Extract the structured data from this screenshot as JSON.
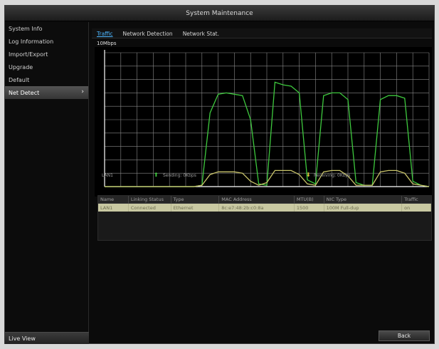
{
  "window": {
    "title": "System Maintenance"
  },
  "sidebar": {
    "items": [
      {
        "label": "System Info",
        "active": false
      },
      {
        "label": "Log Information",
        "active": false
      },
      {
        "label": "Import/Export",
        "active": false
      },
      {
        "label": "Upgrade",
        "active": false
      },
      {
        "label": "Default",
        "active": false
      },
      {
        "label": "Net Detect",
        "active": true,
        "arrow": "›"
      }
    ],
    "bottom_label": "Live View"
  },
  "tabs": [
    {
      "label": "Traffic",
      "active": true
    },
    {
      "label": "Network Detection",
      "active": false
    },
    {
      "label": "Network Stat.",
      "active": false
    }
  ],
  "graph": {
    "unit_label": "10Mbps",
    "legend": {
      "interface": "LAN1",
      "send_label": "Sending: 0Kbps",
      "receive_label": "Receiving: 0Kbps",
      "send_icon": "arrow-up-icon",
      "receive_icon": "arrow-down-icon"
    },
    "colors": {
      "grid": "#8a8a8a",
      "send": "#3ec93e",
      "receive": "#c9c46a",
      "axis": "#ffffff"
    }
  },
  "chart_data": {
    "type": "line",
    "title": "",
    "xlabel": "",
    "ylabel": "10Mbps",
    "grid": true,
    "y_gridlines": 10,
    "x_gridlines": 20,
    "ylim": [
      0,
      10
    ],
    "x": [
      0,
      1,
      2,
      3,
      4,
      5,
      6,
      7,
      8,
      9,
      10,
      11,
      12,
      13,
      14,
      15,
      16,
      17,
      18,
      19,
      20,
      21,
      22,
      23,
      24,
      25,
      26,
      27,
      28,
      29,
      30,
      31,
      32,
      33,
      34,
      35,
      36,
      37,
      38,
      39,
      40
    ],
    "series": [
      {
        "name": "Sending",
        "color": "#3ec93e",
        "values": [
          0,
          0,
          0,
          0,
          0,
          0,
          0,
          0,
          0,
          0,
          0,
          0,
          0.1,
          5.5,
          6.9,
          7.0,
          6.9,
          6.8,
          5.0,
          0.2,
          0.1,
          7.8,
          7.6,
          7.5,
          7.0,
          0.5,
          0.2,
          6.8,
          7.0,
          7.0,
          6.5,
          0.3,
          0.1,
          0.1,
          6.5,
          6.8,
          6.8,
          6.6,
          0.4,
          0.1,
          0
        ]
      },
      {
        "name": "Receiving",
        "color": "#c9c46a",
        "values": [
          0,
          0,
          0,
          0,
          0,
          0,
          0,
          0,
          0,
          0,
          0,
          0,
          0.1,
          0.9,
          1.1,
          1.1,
          1.1,
          1.0,
          0.4,
          0.1,
          0.3,
          1.2,
          1.2,
          1.2,
          0.9,
          0.2,
          0.1,
          1.1,
          1.2,
          1.2,
          0.8,
          0.1,
          0.1,
          0.1,
          1.1,
          1.2,
          1.2,
          1.0,
          0.2,
          0.1,
          0
        ]
      }
    ]
  },
  "nic_table": {
    "columns": [
      "Name",
      "Linking Status",
      "Type",
      "MAC Address",
      "MTU(B)",
      "NIC Type",
      "Traffic"
    ],
    "rows": [
      [
        "LAN1",
        "Connected",
        "Ethernet",
        "8c:e7:48:2b:c0:8a",
        "1500",
        "100M Full-dup",
        "on"
      ]
    ]
  },
  "footer": {
    "back_label": "Back"
  }
}
